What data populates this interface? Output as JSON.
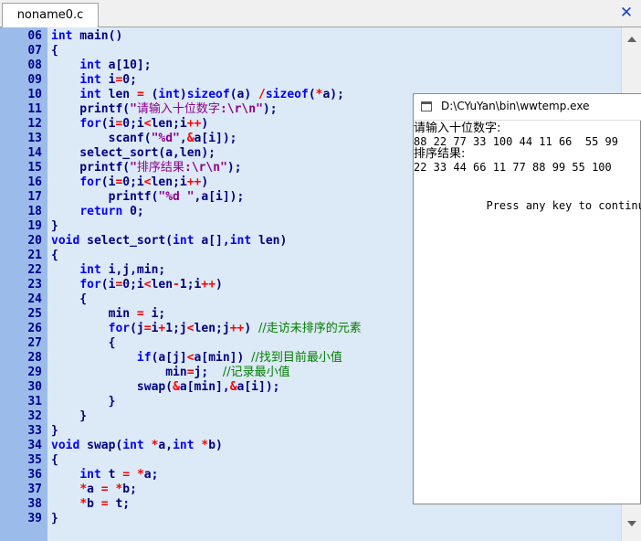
{
  "tab": {
    "label": "noname0.c"
  },
  "code_lines": [
    {
      "num": "06",
      "segs": [
        [
          "kw",
          "int"
        ],
        [
          "",
          " main()"
        ]
      ]
    },
    {
      "num": "07",
      "segs": [
        [
          "",
          "{"
        ]
      ]
    },
    {
      "num": "08",
      "segs": [
        [
          "",
          "    "
        ],
        [
          "kw",
          "int"
        ],
        [
          "",
          " a[10];"
        ]
      ]
    },
    {
      "num": "09",
      "segs": [
        [
          "",
          "    "
        ],
        [
          "kw",
          "int"
        ],
        [
          "",
          " i"
        ],
        [
          "op",
          "="
        ],
        [
          "",
          "0;"
        ]
      ]
    },
    {
      "num": "10",
      "segs": [
        [
          "",
          "    "
        ],
        [
          "kw",
          "int"
        ],
        [
          "",
          " len "
        ],
        [
          "op",
          "="
        ],
        [
          "",
          " ("
        ],
        [
          "kw",
          "int"
        ],
        [
          "",
          ")"
        ],
        [
          "kw",
          "sizeof"
        ],
        [
          "",
          "(a) "
        ],
        [
          "op",
          "/"
        ],
        [
          "kw",
          "sizeof"
        ],
        [
          "",
          "("
        ],
        [
          "op",
          "*"
        ],
        [
          "",
          "a);"
        ]
      ]
    },
    {
      "num": "11",
      "segs": [
        [
          "",
          "    printf("
        ],
        [
          "str",
          "\""
        ],
        [
          "str cn",
          "请输入十位数字"
        ],
        [
          "str",
          ":\\r\\n\""
        ],
        [
          "",
          ");"
        ]
      ]
    },
    {
      "num": "12",
      "segs": [
        [
          "",
          "    "
        ],
        [
          "kw",
          "for"
        ],
        [
          "",
          "(i"
        ],
        [
          "op",
          "="
        ],
        [
          "",
          "0;i"
        ],
        [
          "op",
          "<"
        ],
        [
          "",
          "len;i"
        ],
        [
          "op",
          "++"
        ],
        [
          "",
          ")"
        ]
      ]
    },
    {
      "num": "13",
      "segs": [
        [
          "",
          "        scanf("
        ],
        [
          "str",
          "\"%d\""
        ],
        [
          "",
          ","
        ],
        [
          "op",
          "&"
        ],
        [
          "",
          "a[i]);"
        ]
      ]
    },
    {
      "num": "14",
      "segs": [
        [
          "",
          "    select_sort(a,len);"
        ]
      ]
    },
    {
      "num": "15",
      "segs": [
        [
          "",
          "    printf("
        ],
        [
          "str",
          "\""
        ],
        [
          "str cn",
          "排序结果"
        ],
        [
          "str",
          ":\\r\\n\""
        ],
        [
          "",
          ");"
        ]
      ]
    },
    {
      "num": "16",
      "segs": [
        [
          "",
          "    "
        ],
        [
          "kw",
          "for"
        ],
        [
          "",
          "(i"
        ],
        [
          "op",
          "="
        ],
        [
          "",
          "0;i"
        ],
        [
          "op",
          "<"
        ],
        [
          "",
          "len;i"
        ],
        [
          "op",
          "++"
        ],
        [
          "",
          ")"
        ]
      ]
    },
    {
      "num": "17",
      "segs": [
        [
          "",
          "        printf("
        ],
        [
          "str",
          "\"%d \""
        ],
        [
          "",
          ",a[i]);"
        ]
      ]
    },
    {
      "num": "18",
      "segs": [
        [
          "",
          "    "
        ],
        [
          "kw",
          "return"
        ],
        [
          "",
          " 0;"
        ]
      ]
    },
    {
      "num": "19",
      "segs": [
        [
          "",
          "}"
        ]
      ]
    },
    {
      "num": "20",
      "segs": [
        [
          "kw",
          "void"
        ],
        [
          "",
          " select_sort("
        ],
        [
          "kw",
          "int"
        ],
        [
          "",
          " a[],"
        ],
        [
          "kw",
          "int"
        ],
        [
          "",
          " len)"
        ]
      ]
    },
    {
      "num": "21",
      "segs": [
        [
          "",
          "{"
        ]
      ]
    },
    {
      "num": "22",
      "segs": [
        [
          "",
          "    "
        ],
        [
          "kw",
          "int"
        ],
        [
          "",
          " i,j,min;"
        ]
      ]
    },
    {
      "num": "23",
      "segs": [
        [
          "",
          "    "
        ],
        [
          "kw",
          "for"
        ],
        [
          "",
          "(i"
        ],
        [
          "op",
          "="
        ],
        [
          "",
          "0;i"
        ],
        [
          "op",
          "<"
        ],
        [
          "",
          "len"
        ],
        [
          "op",
          "-"
        ],
        [
          "",
          "1;i"
        ],
        [
          "op",
          "++"
        ],
        [
          "",
          ")"
        ]
      ]
    },
    {
      "num": "24",
      "segs": [
        [
          "",
          "    {"
        ]
      ]
    },
    {
      "num": "25",
      "segs": [
        [
          "",
          "        min "
        ],
        [
          "op",
          "="
        ],
        [
          "",
          " i;"
        ]
      ]
    },
    {
      "num": "26",
      "segs": [
        [
          "",
          "        "
        ],
        [
          "kw",
          "for"
        ],
        [
          "",
          "(j"
        ],
        [
          "op",
          "="
        ],
        [
          "",
          "i"
        ],
        [
          "op",
          "+"
        ],
        [
          "",
          "1;j"
        ],
        [
          "op",
          "<"
        ],
        [
          "",
          "len;j"
        ],
        [
          "op",
          "++"
        ],
        [
          "",
          ") "
        ],
        [
          "cmt",
          "//走访未排序的元素"
        ]
      ]
    },
    {
      "num": "27",
      "segs": [
        [
          "",
          "        {"
        ]
      ]
    },
    {
      "num": "28",
      "segs": [
        [
          "",
          "            "
        ],
        [
          "kw",
          "if"
        ],
        [
          "",
          "(a[j]"
        ],
        [
          "op",
          "<"
        ],
        [
          "",
          "a[min]) "
        ],
        [
          "cmt",
          "//找到目前最小值"
        ]
      ]
    },
    {
      "num": "29",
      "segs": [
        [
          "",
          "                min"
        ],
        [
          "op",
          "="
        ],
        [
          "",
          "j;  "
        ],
        [
          "cmt",
          "//记录最小值"
        ]
      ]
    },
    {
      "num": "30",
      "segs": [
        [
          "",
          "            swap("
        ],
        [
          "op",
          "&"
        ],
        [
          "",
          "a[min],"
        ],
        [
          "op",
          "&"
        ],
        [
          "",
          "a[i]);"
        ]
      ]
    },
    {
      "num": "31",
      "segs": [
        [
          "",
          "        }"
        ]
      ]
    },
    {
      "num": "32",
      "segs": [
        [
          "",
          "    }"
        ]
      ]
    },
    {
      "num": "33",
      "segs": [
        [
          "",
          "}"
        ]
      ]
    },
    {
      "num": "34",
      "segs": [
        [
          "kw",
          "void"
        ],
        [
          "",
          " swap("
        ],
        [
          "kw",
          "int"
        ],
        [
          "",
          " "
        ],
        [
          "op",
          "*"
        ],
        [
          "",
          "a,"
        ],
        [
          "kw",
          "int"
        ],
        [
          "",
          " "
        ],
        [
          "op",
          "*"
        ],
        [
          "",
          "b)"
        ]
      ]
    },
    {
      "num": "35",
      "segs": [
        [
          "",
          "{"
        ]
      ]
    },
    {
      "num": "36",
      "segs": [
        [
          "",
          "    "
        ],
        [
          "kw",
          "int"
        ],
        [
          "",
          " t "
        ],
        [
          "op",
          "="
        ],
        [
          "",
          " "
        ],
        [
          "op",
          "*"
        ],
        [
          "",
          "a;"
        ]
      ]
    },
    {
      "num": "37",
      "segs": [
        [
          "",
          "    "
        ],
        [
          "op",
          "*"
        ],
        [
          "",
          "a "
        ],
        [
          "op",
          "="
        ],
        [
          "",
          " "
        ],
        [
          "op",
          "*"
        ],
        [
          "",
          "b;"
        ]
      ]
    },
    {
      "num": "38",
      "segs": [
        [
          "",
          "    "
        ],
        [
          "op",
          "*"
        ],
        [
          "",
          "b "
        ],
        [
          "op",
          "="
        ],
        [
          "",
          " t;"
        ]
      ]
    },
    {
      "num": "39",
      "segs": [
        [
          "",
          "}"
        ]
      ]
    }
  ],
  "console": {
    "title": "D:\\CYuYan\\bin\\wwtemp.exe",
    "lines": [
      {
        "text": "请输入十位数字:",
        "cn": true
      },
      {
        "text": "88 22 77 33 100 44 11 66  55 99",
        "cn": false
      },
      {
        "text": "排序结果:",
        "cn": true
      },
      {
        "text": "22 33 44 66 11 77 88 99 55 100",
        "cn": false
      },
      {
        "text": "",
        "cn": false
      },
      {
        "text": "",
        "cn": false
      },
      {
        "text": "           Press any key to continue",
        "cn": false
      }
    ]
  },
  "icons": {
    "close": "close-icon",
    "scroll_up": "scroll-up-icon",
    "scroll_down": "scroll-down-icon",
    "console_window": "window-icon"
  },
  "colors": {
    "gutter": "#9bbcea",
    "editor_bg": "#dce9f6",
    "keyword": "#0000ff",
    "string": "#8b008b",
    "comment": "#008000",
    "operator": "#ff0000",
    "text": "#000080"
  }
}
